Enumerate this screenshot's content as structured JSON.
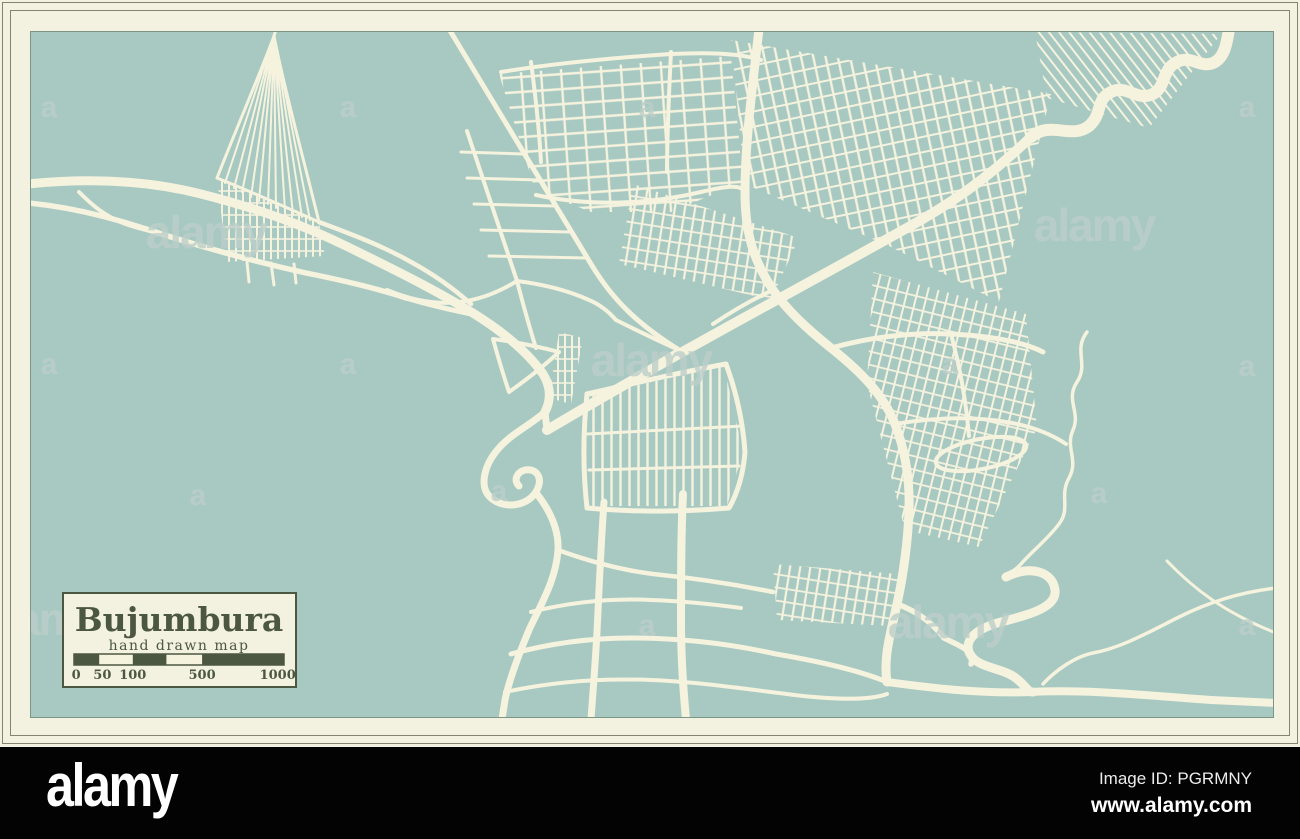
{
  "map_card": {
    "title": "Bujumbura",
    "subtitle": "hand drawn map"
  },
  "scale_bar": {
    "labels": [
      "0",
      "50",
      "100",
      "500",
      "1000"
    ],
    "label_pos_pct": [
      1,
      13.5,
      28,
      61,
      97
    ],
    "segments_pct": [
      [
        0,
        12,
        "dark"
      ],
      [
        12,
        28,
        "light"
      ],
      [
        28,
        44,
        "dark"
      ],
      [
        44,
        61,
        "light"
      ],
      [
        61,
        100,
        "dark"
      ]
    ]
  },
  "watermark": {
    "word": "alamy",
    "letter": "a"
  },
  "footer": {
    "brand": "alamy",
    "image_id": "Image ID: PGRMNY",
    "website": "www.alamy.com"
  },
  "colors": {
    "cream": "#f3f1df",
    "teal": "#a7c9c1",
    "road": "#f5f2de",
    "ink": "#4c5741",
    "frame": "#5b604c",
    "wm": "#becfca",
    "bar": "#030303",
    "white": "#ffffff"
  }
}
